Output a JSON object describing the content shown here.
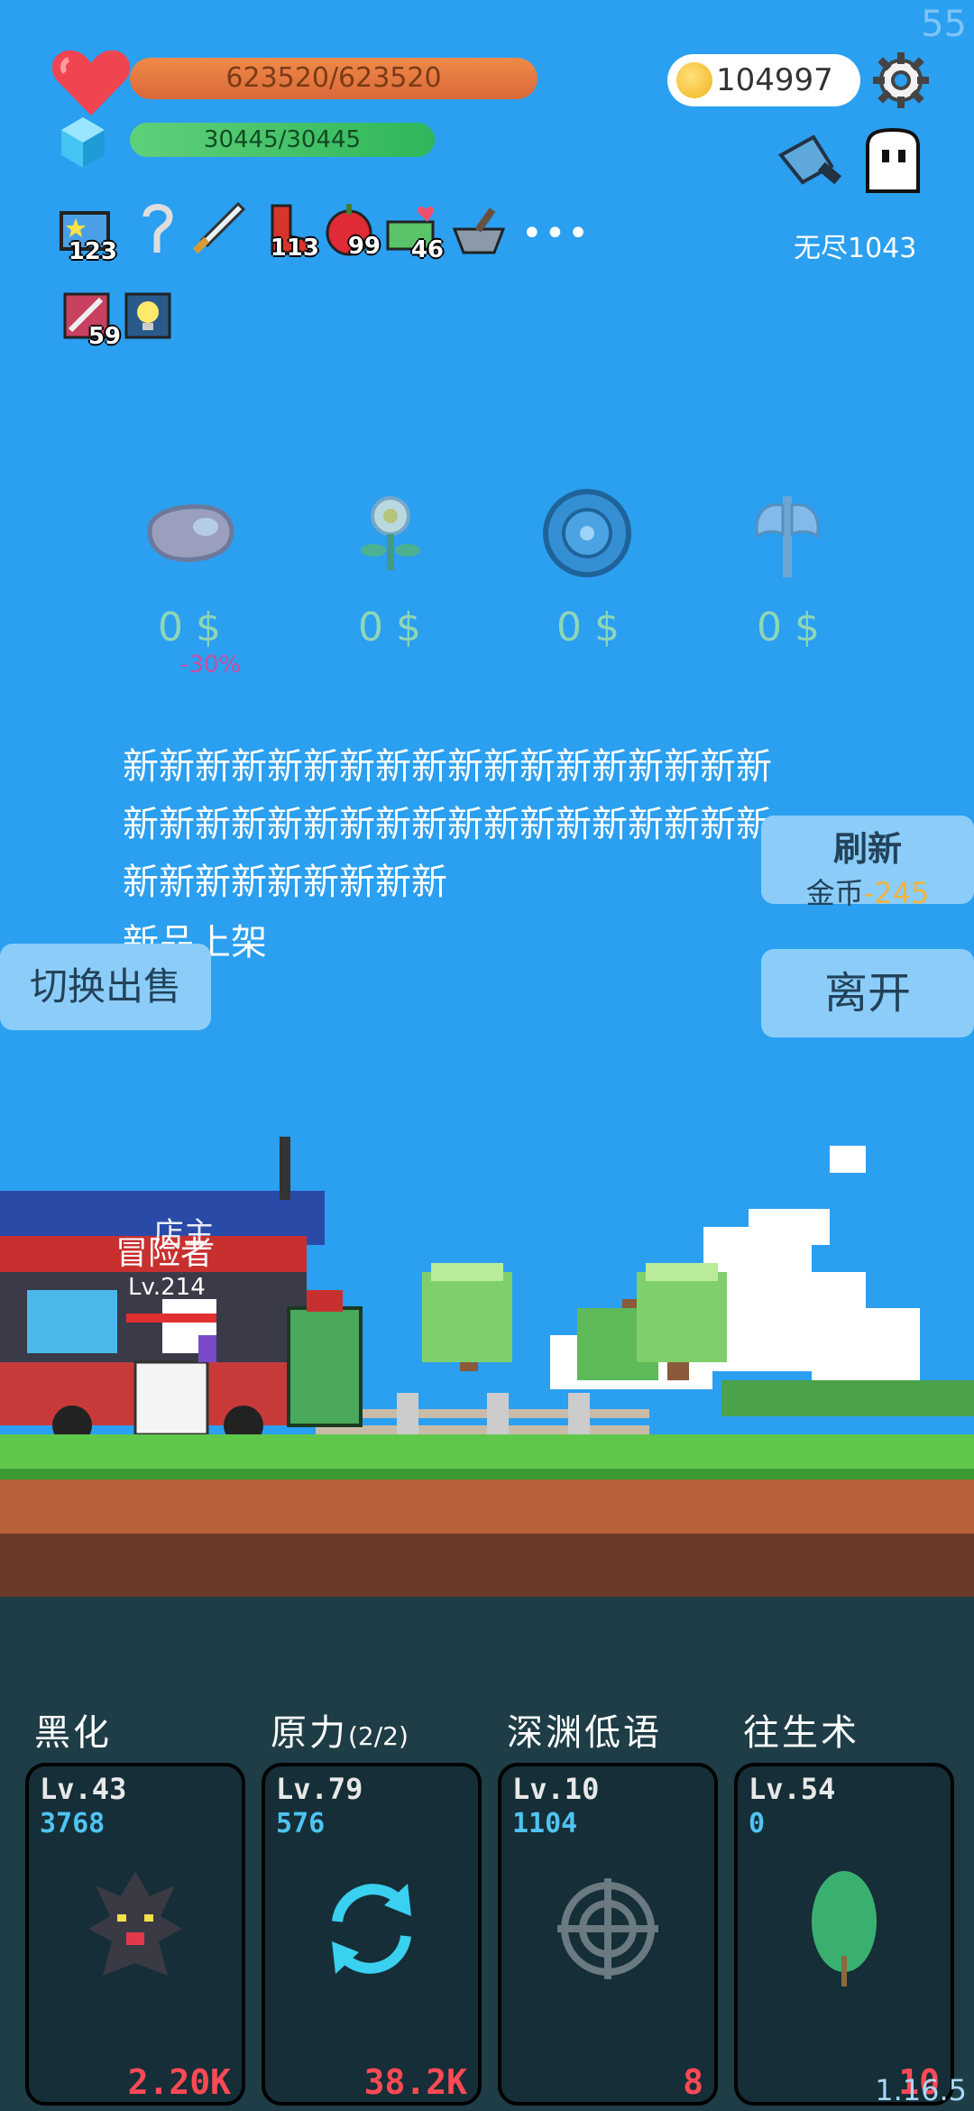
{
  "fps": "55",
  "version": "1.16.5",
  "hp": "623520/623520",
  "mp": "30445/30445",
  "coins": "104997",
  "endless": "无尽1043",
  "inventory": [
    {
      "icon": "star-card-icon",
      "count": "123"
    },
    {
      "icon": "hook-icon",
      "count": ""
    },
    {
      "icon": "sword-icon",
      "count": ""
    },
    {
      "icon": "boot-icon",
      "count": "113"
    },
    {
      "icon": "apple-icon",
      "count": "99"
    },
    {
      "icon": "cash-heart-icon",
      "count": "46"
    },
    {
      "icon": "mortar-icon",
      "count": ""
    },
    {
      "icon": "scroll-icon",
      "count": "59"
    },
    {
      "icon": "bulb-icon",
      "count": ""
    }
  ],
  "more": "•••",
  "shop": [
    {
      "icon": "meat-icon",
      "price": "0 $"
    },
    {
      "icon": "flower-icon",
      "price": "0 $"
    },
    {
      "icon": "shield-icon",
      "price": "0 $"
    },
    {
      "icon": "axe-icon",
      "price": "0 $"
    }
  ],
  "discount": "-30%",
  "new_text": "新新新新新新新新新新新新新新新新新新新新新新新新新新新新新新新新新新新新新新新新新新新新新",
  "new_items": "新品上架",
  "refresh_label": "刷新",
  "refresh_cost_label": "金币",
  "refresh_cost": "-245",
  "leave_label": "离开",
  "switch_label": "切换出售",
  "scene": {
    "shopkeeper": "店主",
    "player": "冒险者",
    "player_level": "Lv.214"
  },
  "skills": [
    {
      "name": "黑化",
      "extra": "",
      "level": "Lv.43",
      "value": "3768",
      "cost": "2.20K",
      "icon": "dark-tree-icon"
    },
    {
      "name": "原力",
      "extra": "(2/2)",
      "level": "Lv.79",
      "value": "576",
      "cost": "38.2K",
      "icon": "cycle-icon"
    },
    {
      "name": "深渊低语",
      "extra": "",
      "level": "Lv.10",
      "value": "1104",
      "cost": "8",
      "icon": "crosshair-icon"
    },
    {
      "name": "往生术",
      "extra": "",
      "level": "Lv.54",
      "value": "0",
      "cost": "10",
      "icon": "leaf-icon"
    }
  ]
}
